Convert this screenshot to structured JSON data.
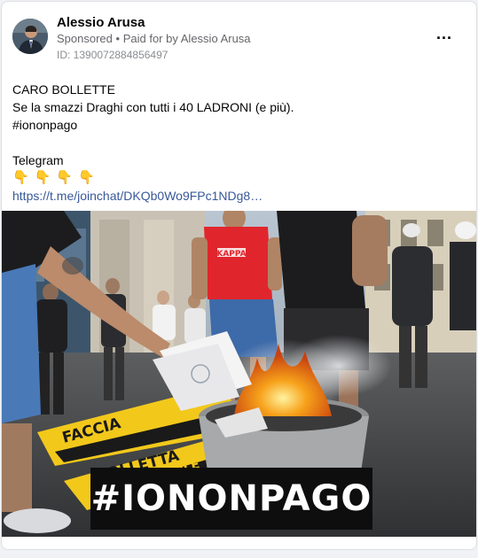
{
  "post": {
    "page_name": "Alessio Arusa",
    "sponsored_label": "Sponsored",
    "separator": "•",
    "paid_for_label": "Paid for by",
    "payer_name": "Alessio Arusa",
    "ad_id": "ID: 1390072884856497",
    "more_icon": "more-horizontal-icon"
  },
  "body": {
    "line1": "CARO BOLLETTE",
    "line2": "Se la smazzi Draghi con tutti i 40 LADRONI (e più).",
    "line3": "#iononpago",
    "line4": "Telegram",
    "emoji": "👇",
    "link": "https://t.me/joinchat/DKQb0Wo9FPc1NDg8…"
  },
  "image": {
    "overlay_text": "#IONONPAGO",
    "shirt_text": "KAPPA",
    "banner_text_1": "FACCIA",
    "banner_text_2": "BOLLETTA",
    "banner_text_3": "ORDINANDOLE"
  },
  "colors": {
    "link": "#385898",
    "secondary_text": "#65676b",
    "card_bg": "#ffffff",
    "page_bg": "#f0f2f5",
    "banner_yellow": "#f2c81b",
    "shirt_red": "#e0262c",
    "fire_orange": "#f08a1a"
  }
}
